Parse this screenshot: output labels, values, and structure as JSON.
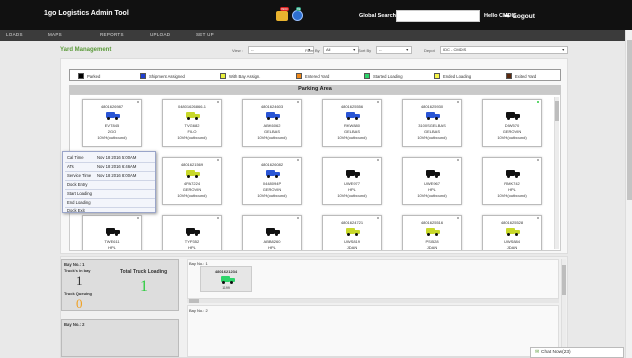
{
  "app": {
    "title": "1go Logistics Admin Tool"
  },
  "header": {
    "cart_badge": "9900",
    "globe_badge": "69",
    "global_search_label": "Global Search:",
    "global_search_value": "",
    "greeting": "Hello CMDIS",
    "logout_label": "Logout"
  },
  "menu": [
    "LOADS",
    "MAPS",
    "REPORTS",
    "UPLOAD",
    "SET UP"
  ],
  "page": {
    "title": "Yard Management"
  },
  "filters": {
    "view": {
      "label": "View :",
      "value": "--"
    },
    "filter_by": {
      "label": "Filter By",
      "value": "All"
    },
    "sort_by": {
      "label": "Sort By",
      "value": "--"
    },
    "depot": {
      "label": "Depot",
      "value": "IDC - CMDIS"
    }
  },
  "legend": [
    {
      "label": "Parked",
      "color": "#000000"
    },
    {
      "label": "Shipment Assigned",
      "color": "#1f3fd1"
    },
    {
      "label": "With Bay Assign.",
      "color": "#e8f03c"
    },
    {
      "label": "Entered Yard",
      "color": "#f08a1c"
    },
    {
      "label": "Started Loading",
      "color": "#2ed46a"
    },
    {
      "label": "Ended Loading",
      "color": "#f6f64a"
    },
    {
      "label": "Exited Yard",
      "color": "#5a2a10"
    }
  ],
  "parking": {
    "title": "Parking Area",
    "cards": [
      {
        "id": "4801626987",
        "color": "#2a56d6",
        "lines": [
          "EVT845",
          "2GO",
          "10VH(outbound)"
        ],
        "dot": "grey"
      },
      {
        "id": "04801626866-1",
        "color": "#c8d82a",
        "lines": [
          "TVG682",
          "FILO",
          "10VH(outbound)"
        ],
        "dot": "grey"
      },
      {
        "id": "4801624603",
        "color": "#2a56d6",
        "lines": [
          "ABK6062",
          "GELBAS",
          "10VH(outbound)"
        ],
        "dot": "grey"
      },
      {
        "id": "4801625556",
        "color": "#2a56d6",
        "lines": [
          "RKW880",
          "GELBAS",
          "10VH(outbound)"
        ],
        "dot": "grey"
      },
      {
        "id": "4801625930",
        "color": "#2a56d6",
        "lines": [
          "3100SGELBAS",
          "GELBAS",
          "10VH(outbound)"
        ],
        "dot": "grey"
      },
      {
        "id": "",
        "color": "#111111",
        "lines": [
          "DIW570",
          "GEROVIN",
          "10VH(outbound)"
        ],
        "dot": "green"
      },
      {
        "id": "",
        "color": "#111111",
        "lines": [
          "",
          "",
          ""
        ],
        "dot": "grey"
      },
      {
        "id": "4801621569",
        "color": "#c8d82a",
        "lines": [
          "4PA7224",
          "GEROVIN",
          "10VH(outbound)"
        ],
        "dot": "grey"
      },
      {
        "id": "4801626082",
        "color": "#2a56d6",
        "lines": [
          "0448094P",
          "GEROVIN",
          "10VH(outbound)"
        ],
        "dot": "grey"
      },
      {
        "id": "",
        "color": "#111111",
        "lines": [
          "UWE977",
          "HPL",
          "10VH(outbound)"
        ],
        "dot": "grey"
      },
      {
        "id": "",
        "color": "#111111",
        "lines": [
          "UWE967",
          "HPL",
          "10VH(outbound)"
        ],
        "dot": "grey"
      },
      {
        "id": "",
        "color": "#111111",
        "lines": [
          "RMK742",
          "HPL",
          "10VH(outbound)"
        ],
        "dot": "grey"
      },
      {
        "id": "",
        "color": "#111111",
        "lines": [
          "TWE611",
          "HPL",
          "10VH(outbound)"
        ],
        "dot": "grey"
      },
      {
        "id": "",
        "color": "#111111",
        "lines": [
          "TYP352",
          "HPL",
          "10VH(outbound)"
        ],
        "dot": "grey"
      },
      {
        "id": "",
        "color": "#111111",
        "lines": [
          "ABB8260",
          "HPL",
          "10VH(outbound)"
        ],
        "dot": "grey"
      },
      {
        "id": "4801624721",
        "color": "#c8d82a",
        "lines": [
          "UWS819",
          "JDAN",
          "10VH(outbound)"
        ],
        "dot": "grey"
      },
      {
        "id": "4801625516",
        "color": "#c8d82a",
        "lines": [
          "PSI528",
          "JDAN",
          "10VH(outbound)"
        ],
        "dot": "grey"
      },
      {
        "id": "4801625528",
        "color": "#c8d82a",
        "lines": [
          "UWS884",
          "JDAN",
          "10VH(outbound)"
        ],
        "dot": "grey"
      }
    ]
  },
  "popup": {
    "rows": [
      {
        "label": "Cal Time",
        "value": "Nov 18 2016 5:00AM"
      },
      {
        "label": "ATs",
        "value": "Nov 18 2016 6:46AM"
      },
      {
        "label": "Service Time",
        "value": "Nov 18 2016 8:00AM"
      },
      {
        "label": "Dock Entry",
        "value": ""
      },
      {
        "label": "Start Loading",
        "value": ""
      },
      {
        "label": "End Loading",
        "value": ""
      },
      {
        "label": "Dock Exit",
        "value": ""
      }
    ]
  },
  "bays": [
    {
      "title": "Bay No.: 1",
      "trucks_in_bay_label": "Truck's in bay",
      "trucks_in_bay": "1",
      "total_label": "Total Truck Loading",
      "total": "1",
      "queuing_label": "Truck Queuing",
      "queuing": "0",
      "row_tag": "Bay No.: 1",
      "card_id": "4801621234",
      "card_sub": "1199",
      "card_color": "#2ed46a"
    },
    {
      "title": "Bay No.: 2",
      "row_tag": "Bay No.: 2"
    }
  ],
  "chat": {
    "label": "Chat Now(23)"
  },
  "icons": {
    "cart": "cart-icon",
    "globe": "globe-icon",
    "logout": "arrow-right-icon",
    "chat": "chat-icon"
  }
}
